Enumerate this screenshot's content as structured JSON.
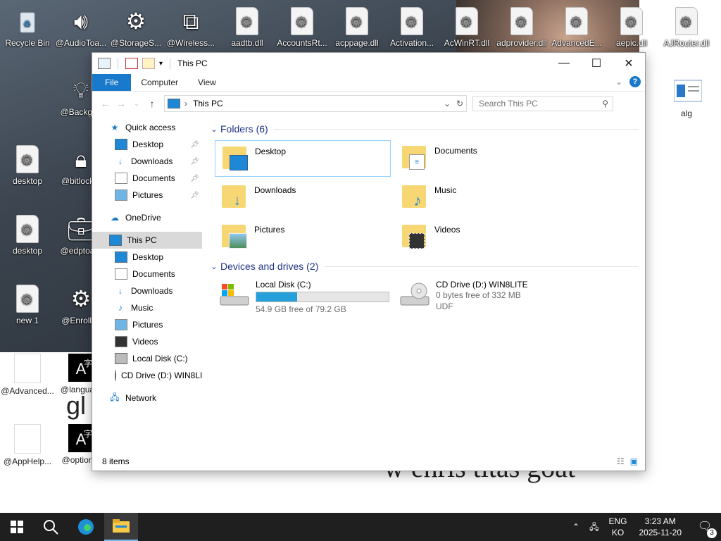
{
  "desktop": {
    "wallpaper_text": "w ehris titas goat",
    "wallpaper_fragment": "gl",
    "icons": [
      {
        "label": "Recycle Bin",
        "icon": "recycle-bin-icon"
      },
      {
        "label": "@AudioToa...",
        "icon": "speaker-icon"
      },
      {
        "label": "@StorageS...",
        "icon": "gear-icon"
      },
      {
        "label": "@Wireless...",
        "icon": "cast-icon"
      },
      {
        "label": "aadtb.dll",
        "icon": "dll-file-icon"
      },
      {
        "label": "AccountsRt...",
        "icon": "dll-file-icon"
      },
      {
        "label": "acppage.dll",
        "icon": "dll-file-icon"
      },
      {
        "label": "Activation...",
        "icon": "dll-file-icon"
      },
      {
        "label": "AcWinRT.dll",
        "icon": "dll-file-icon"
      },
      {
        "label": "adprovider.dll",
        "icon": "dll-file-icon"
      },
      {
        "label": "AdvancedE...",
        "icon": "dll-file-icon"
      },
      {
        "label": "aepic.dll",
        "icon": "dll-file-icon"
      },
      {
        "label": "AJRouter.dll",
        "icon": "dll-file-icon"
      },
      {
        "label": "@Backgr...",
        "icon": "lightbulb-icon"
      },
      {
        "label": "desktop",
        "icon": "settings-file-icon"
      },
      {
        "label": "@bitlock...",
        "icon": "lock-icon"
      },
      {
        "label": "desktop",
        "icon": "settings-file-icon"
      },
      {
        "label": "@edptoa...",
        "icon": "briefcase-icon"
      },
      {
        "label": "new 1",
        "icon": "settings-file-icon"
      },
      {
        "label": "@Enrolli...",
        "icon": "gear-icon"
      },
      {
        "label": "@Advanced...",
        "icon": "blank-file-icon"
      },
      {
        "label": "@langua...",
        "icon": "language-icon"
      },
      {
        "label": "@AppHelp...",
        "icon": "blank-file-icon"
      },
      {
        "label": "@option...",
        "icon": "language-icon"
      },
      {
        "label": "alg",
        "icon": "window-file-icon"
      }
    ]
  },
  "window": {
    "title": "This PC",
    "controls": {
      "minimize": "—",
      "maximize": "☐",
      "close": "✕"
    },
    "ribbon": {
      "tabs": [
        "File",
        "Computer",
        "View"
      ]
    },
    "address": {
      "location": "This PC"
    },
    "search": {
      "placeholder": "Search This PC"
    },
    "nav": [
      {
        "label": "Quick access",
        "icon": "star-icon",
        "level": "top"
      },
      {
        "label": "Desktop",
        "icon": "desktop-icon",
        "pinned": true
      },
      {
        "label": "Downloads",
        "icon": "download-icon",
        "pinned": true
      },
      {
        "label": "Documents",
        "icon": "documents-icon",
        "pinned": true
      },
      {
        "label": "Pictures",
        "icon": "pictures-icon",
        "pinned": true
      },
      {
        "label": "OneDrive",
        "icon": "cloud-icon",
        "level": "top"
      },
      {
        "label": "This PC",
        "icon": "computer-icon",
        "level": "top",
        "selected": true
      },
      {
        "label": "Desktop",
        "icon": "desktop-icon"
      },
      {
        "label": "Documents",
        "icon": "documents-icon"
      },
      {
        "label": "Downloads",
        "icon": "download-icon"
      },
      {
        "label": "Music",
        "icon": "music-icon"
      },
      {
        "label": "Pictures",
        "icon": "pictures-icon"
      },
      {
        "label": "Videos",
        "icon": "videos-icon"
      },
      {
        "label": "Local Disk (C:)",
        "icon": "disk-icon"
      },
      {
        "label": "CD Drive (D:) WIN8LITE",
        "icon": "cd-icon"
      },
      {
        "label": "Network",
        "icon": "network-icon",
        "level": "top"
      }
    ],
    "groups": {
      "folders": "Folders (6)",
      "drives": "Devices and drives (2)"
    },
    "folders": [
      {
        "name": "Desktop",
        "overlay": "desktop-icon"
      },
      {
        "name": "Documents",
        "overlay": "documents-icon"
      },
      {
        "name": "Downloads",
        "overlay": "download-icon"
      },
      {
        "name": "Music",
        "overlay": "music-icon"
      },
      {
        "name": "Pictures",
        "overlay": "pictures-icon"
      },
      {
        "name": "Videos",
        "overlay": "videos-icon"
      }
    ],
    "drives": [
      {
        "name": "Local Disk (C:)",
        "free": "54.9 GB free of 79.2 GB",
        "used_fraction": 0.307
      },
      {
        "name": "CD Drive (D:) WIN8LITE",
        "free": "0 bytes free of 332 MB",
        "fs": "UDF"
      }
    ],
    "status": {
      "count": "8 items"
    }
  },
  "taskbar": {
    "lang": "ENG",
    "ime": "KO",
    "time": "3:23 AM",
    "date": "2025-11-20",
    "notifications": "3"
  },
  "colors": {
    "accent": "#1979ca",
    "folder": "#f7d674",
    "drive_bar": "#26a0da"
  }
}
